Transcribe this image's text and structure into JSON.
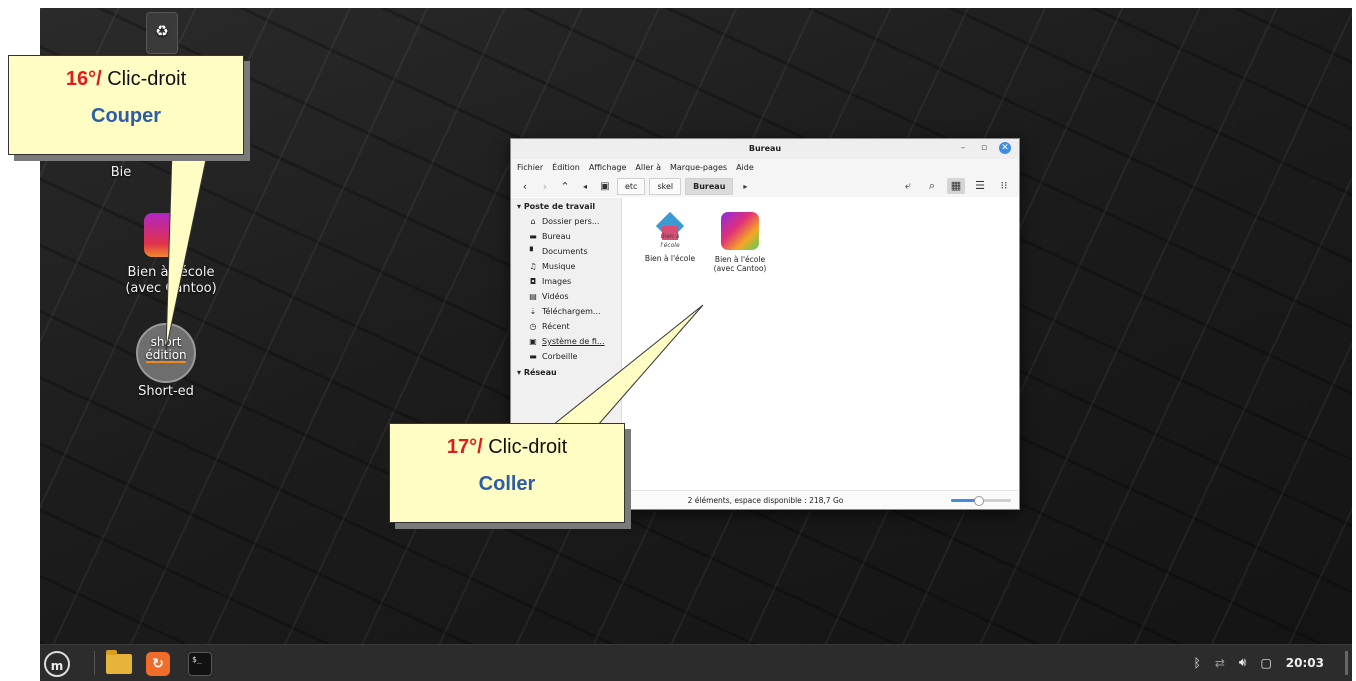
{
  "desktop": {
    "icons": {
      "bien_partial_label": "Bie",
      "cantoo_label_line1": "Bien à l'école",
      "cantoo_label_line2": "(avec Cantoo)",
      "short_disc_text_1": "short",
      "short_disc_text_2": "édition",
      "short_label": "Short-ed"
    }
  },
  "window": {
    "title": "Bureau",
    "controls": {
      "minimize": "–",
      "maximize": "▫",
      "close": "✕"
    },
    "menu": [
      "Fichier",
      "Édition",
      "Affichage",
      "Aller à",
      "Marque-pages",
      "Aide"
    ],
    "breadcrumbs": [
      "etc",
      "skel",
      "Bureau"
    ],
    "sidebar": {
      "section_computer": "Poste de travail",
      "items": [
        {
          "icon": "home-icon",
          "glyph": "⌂",
          "label": "Dossier pers..."
        },
        {
          "icon": "desktop-icon",
          "glyph": "▬",
          "label": "Bureau"
        },
        {
          "icon": "documents-icon",
          "glyph": "▘",
          "label": "Documents"
        },
        {
          "icon": "music-icon",
          "glyph": "♫",
          "label": "Musique"
        },
        {
          "icon": "images-icon",
          "glyph": "◘",
          "label": "Images"
        },
        {
          "icon": "videos-icon",
          "glyph": "▤",
          "label": "Vidéos"
        },
        {
          "icon": "downloads-icon",
          "glyph": "⇣",
          "label": "Téléchargem..."
        },
        {
          "icon": "recent-icon",
          "glyph": "◷",
          "label": "Récent"
        },
        {
          "icon": "filesystem-icon",
          "glyph": "▣",
          "label": "Système de fi..."
        },
        {
          "icon": "trash-icon",
          "glyph": "▬",
          "label": "Corbeille"
        }
      ],
      "section_network": "Réseau"
    },
    "files": [
      {
        "name_line1": "Bien à l'école",
        "name_line2": "",
        "thumb_text": "Bien à l'école"
      },
      {
        "name_line1": "Bien à l'école",
        "name_line2": "(avec Cantoo)"
      }
    ],
    "status": "2 éléments, espace disponible : 218,7 Go",
    "zoom_level": 0.45
  },
  "callouts": {
    "step16": {
      "number": "16°/",
      "action": "Clic-droit",
      "command": "Couper"
    },
    "step17": {
      "number": "17°/",
      "action": "Clic-droit",
      "command": "Coller"
    }
  },
  "taskbar": {
    "menu_label": "m",
    "terminal_glyph": "$_",
    "clock": "20:03"
  }
}
